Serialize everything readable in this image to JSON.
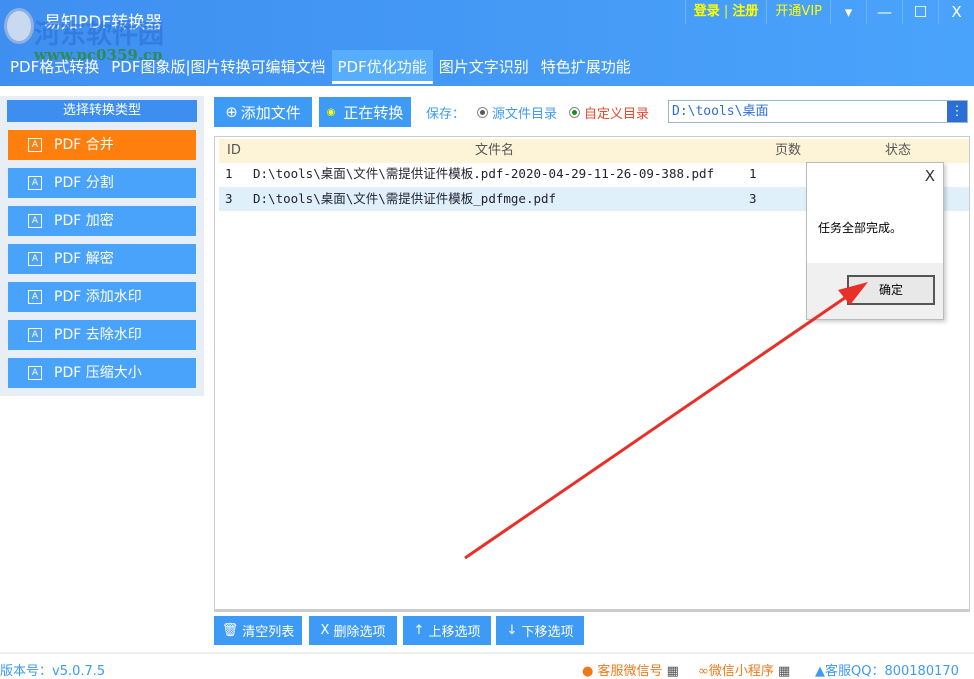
{
  "app": {
    "title": "易知PDF转换器",
    "watermark": "河东软件园",
    "watermark_url": "www.pc0359.cn"
  },
  "window": {
    "login": "登录",
    "register": "注册",
    "vip": "开通VIP",
    "menu": "▾",
    "min": "—",
    "max": "☐",
    "close": "X"
  },
  "tabs": [
    "PDF格式转换",
    "PDF图象版|图片转换可编辑文档",
    "PDF优化功能",
    "图片文字识别",
    "特色扩展功能"
  ],
  "sidebar": {
    "header": "选择转换类型",
    "items": [
      "PDF 合并",
      "PDF 分割",
      "PDF 加密",
      "PDF 解密",
      "PDF 添加水印",
      "PDF 去除水印",
      "PDF 压缩大小"
    ]
  },
  "toolbar": {
    "add": "添加文件",
    "converting": "正在转换",
    "save_label": "保存：",
    "opt_source": "源文件目录",
    "opt_custom": "自定义目录",
    "path": "D:\\tools\\桌面",
    "more": "⋮"
  },
  "table": {
    "columns": [
      "ID",
      "文件名",
      "页数",
      "状态"
    ],
    "rows": [
      {
        "id": "1",
        "name": "D:\\tools\\桌面\\文件\\需提供证件模板.pdf-2020-04-29-11-26-09-388.pdf",
        "pages": "1"
      },
      {
        "id": "3",
        "name": "D:\\tools\\桌面\\文件\\需提供证件模板_pdfmge.pdf",
        "pages": "3"
      }
    ]
  },
  "bottom": {
    "clear": "清空列表",
    "delete": "删除选项",
    "up": "上移选项",
    "down": "下移选项"
  },
  "footer": {
    "version": "版本号：v5.0.7.5",
    "wechat": "客服微信号",
    "mini": "微信小程序",
    "qq": "客服QQ：800180170"
  },
  "dialog": {
    "message": "任务全部完成。",
    "ok": "确定",
    "close": "X"
  },
  "colors": {
    "accent": "#3d9af5",
    "active": "#ff7f0e",
    "arrow": "#e8302a"
  }
}
